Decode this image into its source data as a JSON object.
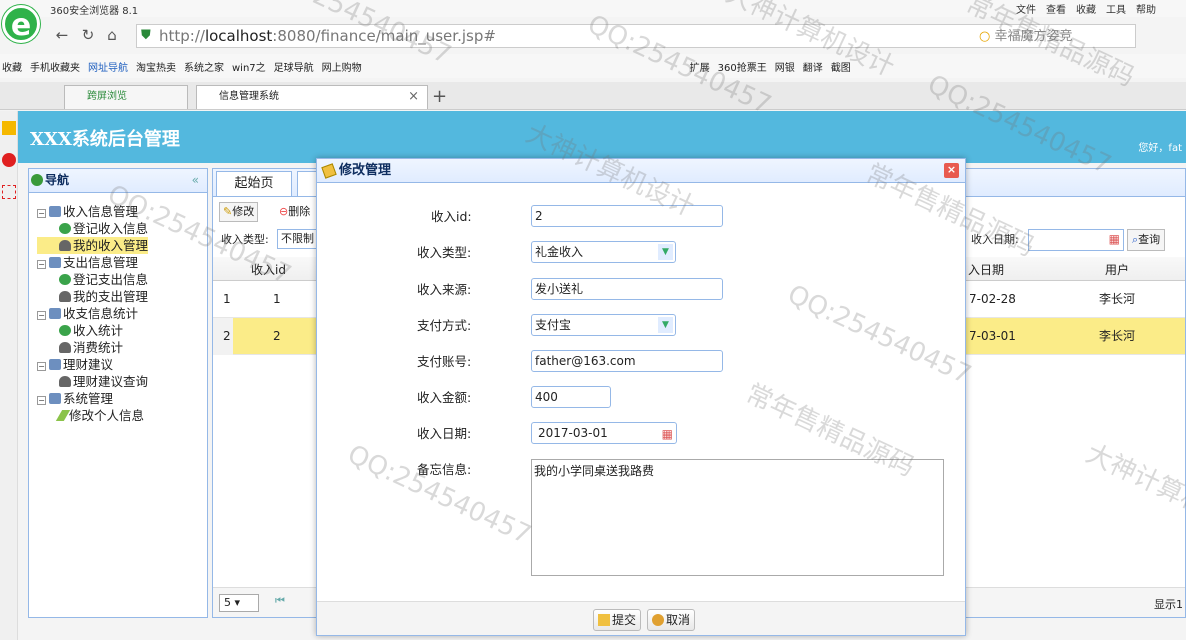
{
  "browser": {
    "app_name": "360安全浏览器 8.1",
    "menu": [
      "文件",
      "查看",
      "收藏",
      "工具",
      "帮助"
    ],
    "url_prefix": "http://",
    "url_host": "localhost",
    "url_rest": ":8080/finance/main_user.jsp#",
    "search_text": "幸福魔方姿竞",
    "favorites": [
      "收藏",
      "手机收藏夹",
      "网址导航",
      "淘宝热卖",
      "系统之家",
      "win7之",
      "足球导航",
      "网上购物"
    ],
    "toolbar_right": [
      "扩展",
      "360抢票王",
      "网银",
      "翻译",
      "截图"
    ],
    "tabs": [
      {
        "label": "跨屏浏览"
      },
      {
        "label": "信息管理系统"
      }
    ],
    "new_tab": "+",
    "tab_close": "×"
  },
  "app": {
    "title": "XXX系统后台管理",
    "greeting": "您好，fat"
  },
  "nav": {
    "title": "导航",
    "collapse": "«",
    "groups": [
      {
        "label": "收入信息管理",
        "items": [
          "登记收入信息",
          "我的收入管理"
        ]
      },
      {
        "label": "支出信息管理",
        "items": [
          "登记支出信息",
          "我的支出管理"
        ]
      },
      {
        "label": "收支信息统计",
        "items": [
          "收入统计",
          "消费统计"
        ]
      },
      {
        "label": "理财建议",
        "items": [
          "理财建议查询"
        ]
      },
      {
        "label": "系统管理",
        "items": [
          "修改个人信息"
        ]
      }
    ]
  },
  "content": {
    "tab_start": "起始页",
    "btn_edit": "修改",
    "btn_delete": "删除",
    "filter_type_label": "收入类型:",
    "filter_type_value": "不限制",
    "filter_date_label": "收入日期:",
    "btn_query": "查询",
    "col_id": "收入id",
    "col_date": "入日期",
    "col_user": "用户",
    "rows": [
      {
        "num": "1",
        "id": "1",
        "date": "7-02-28",
        "user": "李长河"
      },
      {
        "num": "2",
        "id": "2",
        "date": "7-03-01",
        "user": "李长河"
      }
    ],
    "page_size": "5",
    "pager_text": "显示1"
  },
  "dialog": {
    "title": "修改管理",
    "close": "×",
    "fields": {
      "id_label": "收入id:",
      "id_value": "2",
      "type_label": "收入类型:",
      "type_value": "礼金收入",
      "source_label": "收入来源:",
      "source_value": "发小送礼",
      "pay_label": "支付方式:",
      "pay_value": "支付宝",
      "account_label": "支付账号:",
      "account_value": "father@163.com",
      "amount_label": "收入金额:",
      "amount_value": "400",
      "date_label": "收入日期:",
      "date_value": "2017-03-01",
      "memo_label": "备忘信息:",
      "memo_value": "我的小学同桌送我路费"
    },
    "submit": "提交",
    "cancel": "取消"
  },
  "watermarks": [
    "QQ:254540457",
    "大神计算机设计",
    "常年售精品源码",
    "QQ:254540457",
    "QQ:254540457",
    "常年售精品源码",
    "大神计算机设计",
    "QQ:254540457",
    "QQ:254540457",
    "常年售精品源码",
    "QQ:254540457",
    "大神计算机设计"
  ]
}
